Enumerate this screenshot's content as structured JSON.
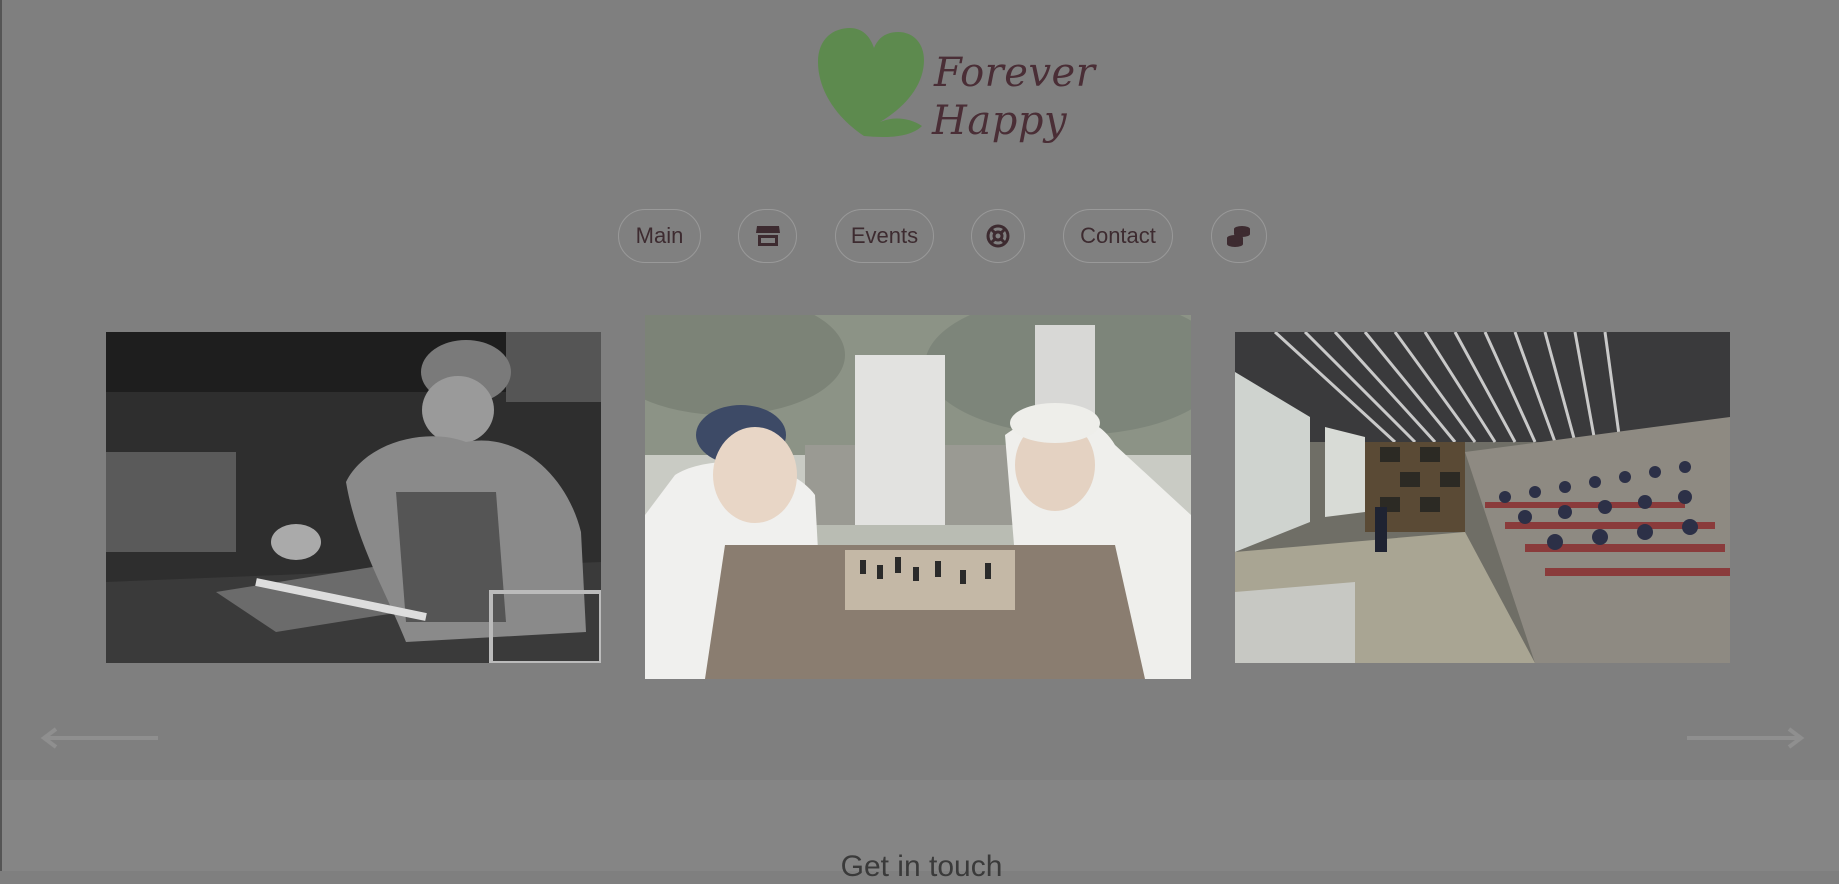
{
  "brand": {
    "line1": "Forever",
    "line2": "Happy",
    "heart_color": "#5d8a4e",
    "text_color": "#4a2e36"
  },
  "nav": {
    "main_label": "Main",
    "shop_icon": "store-icon",
    "events_label": "Events",
    "help_icon": "lifebuoy-icon",
    "contact_label": "Contact",
    "donate_icon": "coins-icon"
  },
  "carousel": {
    "slides": [
      {
        "subject": "man-working-fish-table"
      },
      {
        "subject": "elderly-men-playing-chess"
      },
      {
        "subject": "lecture-hall-audience"
      }
    ],
    "prev_icon": "arrow-left-icon",
    "next_icon": "arrow-right-icon"
  },
  "footer": {
    "title": "Get in touch"
  },
  "colors": {
    "overlay": "#7f7f7f",
    "text": "#3d2b30"
  }
}
